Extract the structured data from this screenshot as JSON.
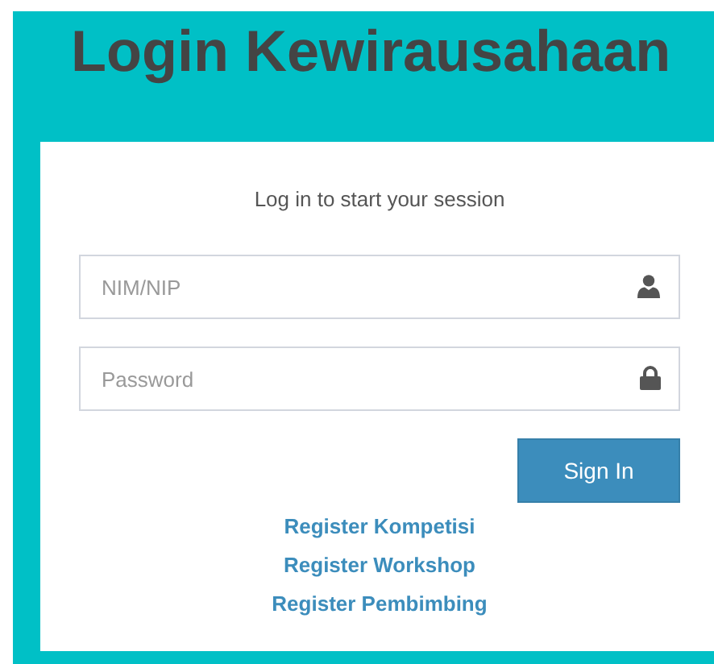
{
  "title": "Login Kewirausahaan",
  "login_box": {
    "message": "Log in to start your session",
    "fields": [
      {
        "placeholder": "NIM/NIP",
        "kind": "user"
      },
      {
        "placeholder": "Password",
        "kind": "password"
      }
    ],
    "button": "Sign In",
    "links": [
      "Register Kompetisi",
      "Register Workshop",
      "Register Pembimbing"
    ]
  }
}
